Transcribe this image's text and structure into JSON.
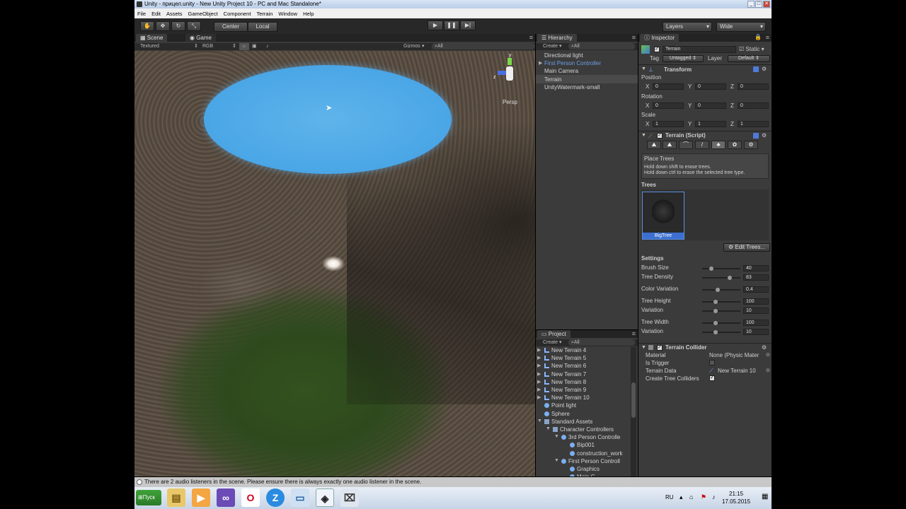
{
  "window": {
    "title": "Unity - прицел.unity - New Unity Project 10 - PC and Mac Standalone*",
    "btn_min": "_",
    "btn_max": "□",
    "btn_close": "✕"
  },
  "menu": [
    "File",
    "Edit",
    "Assets",
    "GameObject",
    "Component",
    "Terrain",
    "Window",
    "Help"
  ],
  "toolbar": {
    "tools": [
      "hand-icon",
      "move-icon",
      "rotate-icon",
      "scale-icon"
    ],
    "pivot": "Center",
    "space": "Local",
    "layers": "Layers",
    "layout": "Wide"
  },
  "scene": {
    "tab_scene": "Scene",
    "tab_game": "Game",
    "render_mode": "Textured",
    "color_mode": "RGB",
    "gizmos": "Gizmos",
    "search": "All",
    "persp": "Persp",
    "gizmo_y": "y",
    "gizmo_z": "z"
  },
  "hierarchy": {
    "title": "Hierarchy",
    "create": "Create",
    "search": "All",
    "items": [
      "Directional light",
      "First Person Controller",
      "Main Camera",
      "Terrain",
      "UnityWatermark-small"
    ]
  },
  "project": {
    "title": "Project",
    "create": "Create",
    "search": "All",
    "items": [
      "New Terrain 4",
      "New Terrain 5",
      "New Terrain 6",
      "New Terrain 7",
      "New Terrain 8",
      "New Terrain 9",
      "New Terrain 10",
      "Point light",
      "Sphere",
      "Standard Assets",
      "Character Controllers",
      "3rd Person Controlle",
      "Bip001",
      "construction_work",
      "First Person Controll",
      "Graphics",
      "Main C"
    ]
  },
  "inspector": {
    "title": "Inspector",
    "object_name": "Terrain",
    "static": "Static",
    "tag_label": "Tag",
    "tag": "Untagged",
    "layer_label": "Layer",
    "layer": "Default",
    "transform": {
      "title": "Transform",
      "position": "Position",
      "rotation": "Rotation",
      "scale": "Scale",
      "x": "X",
      "y": "Y",
      "z": "Z",
      "pos": [
        "0",
        "0",
        "0"
      ],
      "rot": [
        "0",
        "0",
        "0"
      ],
      "scl": [
        "1",
        "1",
        "1"
      ]
    },
    "terrain_script": {
      "title": "Terrain (Script)",
      "mode_title": "Place Trees",
      "hint1": "Hold down shift to erase trees.",
      "hint2": "Hold down ctrl to erase the selected tree type.",
      "trees_label": "Trees",
      "tree_name": "BigTree",
      "edit_trees": "Edit Trees...",
      "settings": "Settings",
      "params": [
        {
          "label": "Brush Size",
          "value": "40",
          "level": 0.2
        },
        {
          "label": "Tree Density",
          "value": "83",
          "level": 0.75
        },
        {
          "label": "Color Variation",
          "value": "0.4",
          "level": 0.4
        },
        {
          "label": "Tree Height",
          "value": "100",
          "level": 0.33
        },
        {
          "label": "Variation",
          "value": "10",
          "level": 0.33
        },
        {
          "label": "Tree Width",
          "value": "100",
          "level": 0.33
        },
        {
          "label": "Variation",
          "value": "10",
          "level": 0.33
        }
      ]
    },
    "collider": {
      "title": "Terrain Collider",
      "material_label": "Material",
      "material": "None (Physic Mater",
      "trigger_label": "Is Trigger",
      "data_label": "Terrain Data",
      "data": "New Terrain 10",
      "create_label": "Create Tree Colliders"
    }
  },
  "status": "There are 2 audio listeners in the scene. Please ensure there is always exactly one audio listener in the scene.",
  "taskbar": {
    "start": "Пуск",
    "lang": "RU",
    "time": "21:15",
    "date": "17.05.2015"
  }
}
